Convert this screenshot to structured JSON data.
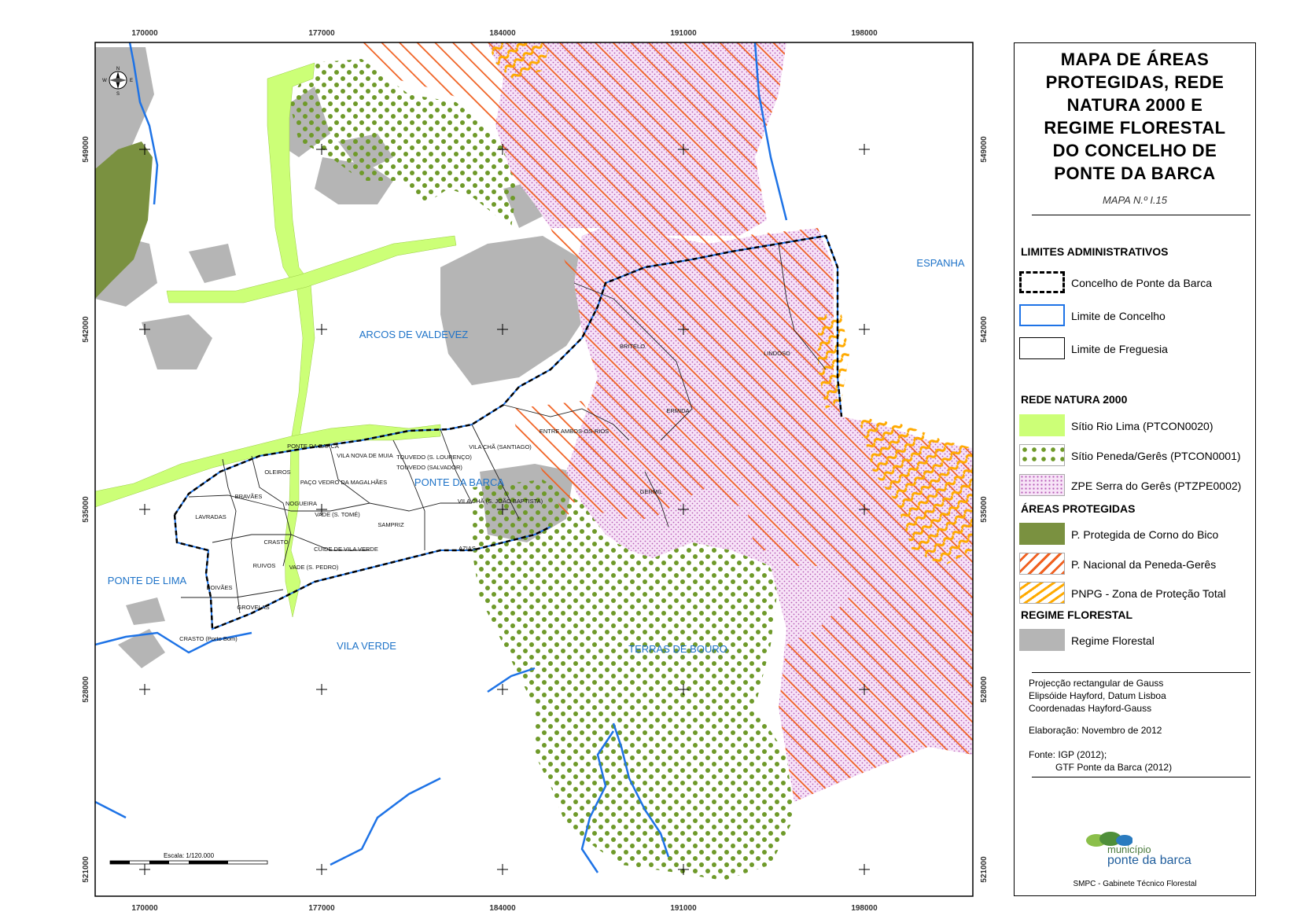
{
  "map": {
    "grid_x": [
      "170000",
      "177000",
      "184000",
      "191000",
      "198000"
    ],
    "grid_y": [
      "549000",
      "542000",
      "535000",
      "528000",
      "521000"
    ],
    "places": {
      "arcos": "ARCOS DE VALDEVEZ",
      "espanha": "ESPANHA",
      "ponte_barca": "PONTE DA BARCA",
      "ponte_lima": "PONTE DE LIMA",
      "vila_verde": "VILA VERDE",
      "terras_bouro": "TERRAS DE BOURO"
    },
    "freguesias": {
      "britelo": "BRITELO",
      "lindoso": "LINDOSO",
      "ermida": "ERMIDA",
      "entre_ambos": "ENTRE AMBOS-OS-RIOS",
      "vila_cha_sant": "VILA CHÃ (SANTIAGO)",
      "touvedo_lour": "TOUVEDO (S. LOURENÇO)",
      "touvedo_salv": "TOUVEDO (SALVADOR)",
      "germil": "GERMIL",
      "vila_cha_joao": "VILA CHÃ (S. JOÃO BAPTISTA)",
      "ponte_barca_f": "PONTE DA BARCA",
      "vila_nova_muia": "VILA NOVA DE MUIA",
      "oleiros": "OLEIROS",
      "paco_vedro": "PAÇO VEDRO DA MAGALHÃES",
      "bravaes": "BRAVÃES",
      "nogueira": "NOGUEIRA",
      "vade_tome": "VADE (S. TOMÉ)",
      "lavradas": "LAVRADAS",
      "sampriz": "SAMPRIZ",
      "azias": "AZIAS",
      "crasto": "CRASTO",
      "cuide": "CUIDE DE VILA VERDE",
      "ruivos": "RUIVOS",
      "vade_pedro": "VADE (S. PEDRO)",
      "boivaes": "BOIVÃES",
      "grovelas": "GROVELAS",
      "crasto_bom": "CRASTO (Porto Bom)"
    },
    "scale_label": "Escala: 1/120.000",
    "north_labels": {
      "n": "N",
      "w": "W",
      "e": "E",
      "s": "S"
    }
  },
  "legend": {
    "title_lines": [
      "MAPA DE ÁREAS",
      "PROTEGIDAS, REDE",
      "NATURA 2000 E",
      "REGIME FLORESTAL",
      "DO CONCELHO DE",
      "PONTE DA BARCA"
    ],
    "subtitle": "MAPA N.º I.15",
    "sec_limites": "LIMITES ADMINISTRATIVOS",
    "concelho_pb": "Concelho de Ponte da Barca",
    "limite_concelho": "Limite de Concelho",
    "limite_freguesia": "Limite de Freguesia",
    "sec_rede": "REDE NATURA 2000",
    "sitio_lima": "Sítio Rio Lima (PTCON0020)",
    "sitio_peneda": "Sítio Peneda/Gerês (PTCON0001)",
    "zpe": "ZPE Serra do Gerês (PTZPE0002)",
    "sec_areas": "ÁREAS PROTEGIDAS",
    "corno_bico": "P. Protegida de Corno do Bico",
    "pnpg": "P. Nacional da Peneda-Gerês",
    "pnpg_zona": "PNPG - Zona de Proteção Total",
    "sec_regime": "REGIME FLORESTAL",
    "regime": "Regime Florestal",
    "proj1": "Projecção rectangular de Gauss",
    "proj2": "Elipsóide Hayford, Datum Lisboa",
    "proj3": "Coordenadas Hayford-Gauss",
    "elaboracao": "Elaboração: Novembro de 2012",
    "fonte1": "Fonte: IGP (2012);",
    "fonte2": "GTF Ponte da Barca (2012)",
    "logo1": "município",
    "logo2": "ponte da barca",
    "footer": "SMPC - Gabinete Técnico Florestal"
  },
  "colors": {
    "rio_lima": "#ccff77",
    "peneda_dot": "#6f9a2a",
    "zpe_dot": "#cc77cc",
    "corno_bico": "#7a9140",
    "pnpg_hatch": "#f06020",
    "zona_total": "#ffaa00",
    "regime": "#b5b5b5",
    "river": "#1e73e6"
  }
}
